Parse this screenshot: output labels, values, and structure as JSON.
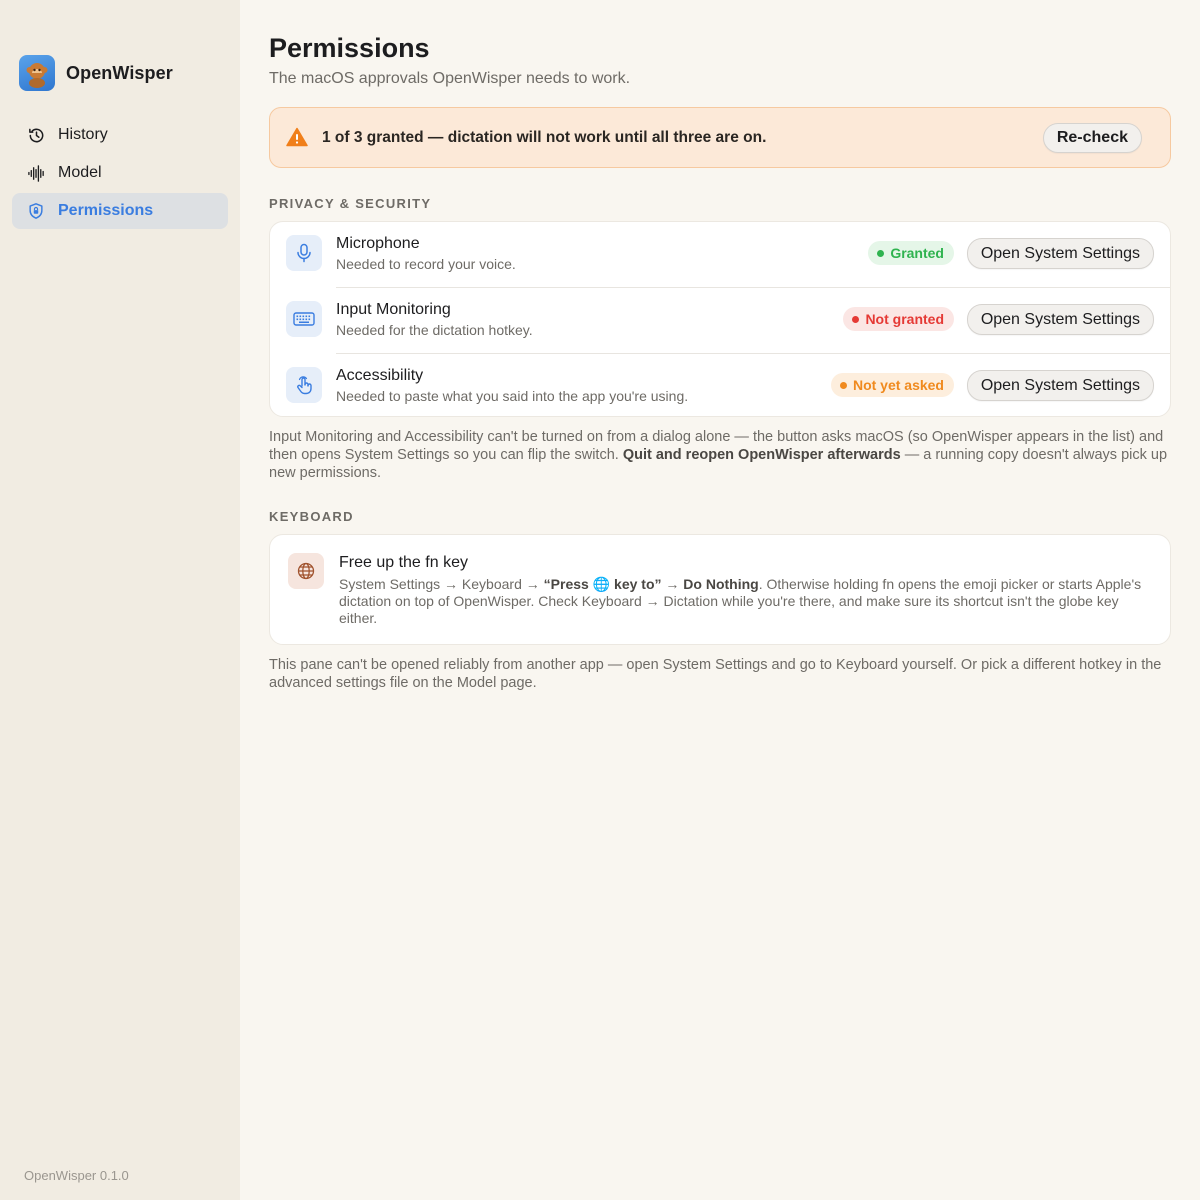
{
  "app": {
    "name": "OpenWisper",
    "version": "OpenWisper 0.1.0"
  },
  "sidebar": {
    "items": [
      {
        "label": "History",
        "icon": "history-icon",
        "active": false
      },
      {
        "label": "Model",
        "icon": "waveform-icon",
        "active": false
      },
      {
        "label": "Permissions",
        "icon": "shield-icon",
        "active": true
      }
    ]
  },
  "header": {
    "title": "Permissions",
    "subtitle": "The macOS approvals OpenWisper needs to work."
  },
  "alert": {
    "icon": "warning-icon",
    "text": "1 of 3 granted — dictation will not work until all three are on.",
    "button_label": "Re-check"
  },
  "privacy": {
    "section_label": "PRIVACY & SECURITY",
    "permissions": [
      {
        "title": "Microphone",
        "description": "Needed to record your voice.",
        "icon": "microphone-icon",
        "status": "Granted",
        "button_label": "Open System Settings"
      },
      {
        "title": "Input Monitoring",
        "description": "Needed for the dictation hotkey.",
        "icon": "keyboard-icon",
        "status": "Not granted",
        "button_label": "Open System Settings"
      },
      {
        "title": "Accessibility",
        "description": "Needed to paste what you said into the app you're using.",
        "icon": "hand-pointer-icon",
        "status": "Not yet asked",
        "button_label": "Open System Settings"
      }
    ],
    "note_part1": "Input Monitoring and Accessibility can't be turned on from a dialog alone — the button asks macOS (so OpenWisper appears in the list) and then opens System Settings so you can flip the switch.",
    "note_bold": "Quit and reopen OpenWisper afterwards",
    "note_part2": "— a running copy doesn't always pick up new permissions."
  },
  "keyboard": {
    "section_label": "KEYBOARD",
    "fn_title": "Free up the fn key",
    "fn_icon": "globe-icon",
    "desc_prefix": "System Settings → Keyboard →",
    "desc_bold1": "“Press",
    "desc_globe": "🌐",
    "desc_bold2": "key to”",
    "desc_arrow": "→",
    "desc_bold3": "Do Nothing",
    "desc_rest": ". Otherwise holding fn opens the emoji picker or starts Apple's dictation on top of OpenWisper. Check Keyboard → Dictation while you're there, and make sure its shortcut isn't the globe key either.",
    "note": "This pane can't be opened reliably from another app — open System Settings and go to Keyboard yourself. Or pick a different hotkey in the advanced settings file on the Model page."
  },
  "colors": {
    "accent": "#3a7de0",
    "granted": "#2fb34f",
    "denied": "#e53935",
    "pending": "#f08a1e",
    "alert_bg": "#fce9d8"
  }
}
